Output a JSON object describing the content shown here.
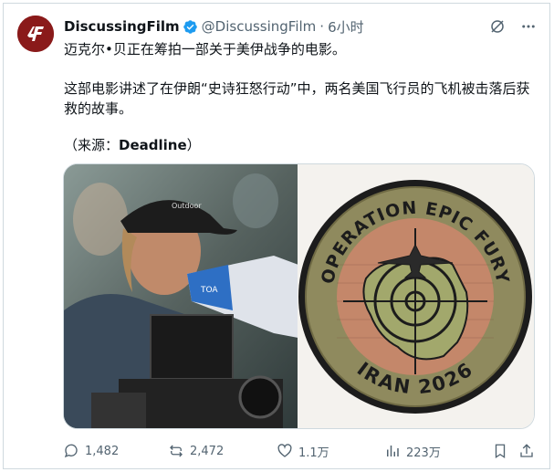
{
  "post": {
    "author_name": "DiscussingFilm",
    "handle": "@DiscussingFilm",
    "separator": "·",
    "time": "6小时",
    "avatar_text": "DF",
    "line1": "迈克尔•贝正在筹拍一部关于美伊战争的电影。",
    "line2": "这部电影讲述了在伊朗“史诗狂怒行动”中，两名美国飞行员的飞机被击落后获救的故事。",
    "source_prefix": "（来源：",
    "source_name": "Deadline",
    "source_suffix": "）"
  },
  "media": {
    "patch_top_text": "OPERATION EPIC FURY",
    "patch_bottom_text": "IRAN 2026",
    "cap_text": "Outdoor",
    "megaphone_text": "TOA"
  },
  "actions": {
    "reply_count": "1,482",
    "repost_count": "2,472",
    "like_count": "1.1万",
    "views_count": "223万"
  },
  "colors": {
    "verified": "#1d9bf0",
    "avatar_bg": "#8a1a1a",
    "patch_outer": "#1c1c1c",
    "patch_olive": "#8f8a5e",
    "patch_tan": "#c4876a",
    "patch_thread": "#b8b27a"
  }
}
